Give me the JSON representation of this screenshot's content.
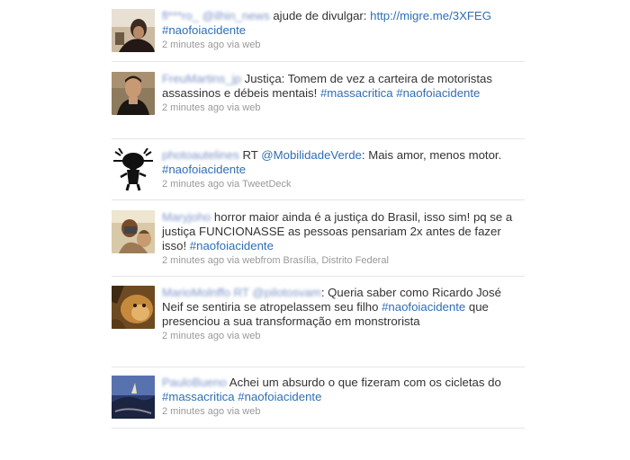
{
  "tweets": [
    {
      "user": "fl***ro_ @ilhin_news",
      "text_parts": [
        {
          "t": " ajude de divulgar: ",
          "k": "text"
        },
        {
          "t": "http://migre.me/3XFEG",
          "k": "link"
        },
        {
          "t": " ",
          "k": "text"
        },
        {
          "t": "#naofoiacidente",
          "k": "tag"
        }
      ],
      "time": "2 minutes ago",
      "via": "via",
      "source": "web",
      "location": ""
    },
    {
      "user": "FreuMartins_jp",
      "text_parts": [
        {
          "t": " Justiça: Tomem de vez a carteira de motoristas assassinos e débeis mentais! ",
          "k": "text"
        },
        {
          "t": "#massacritica",
          "k": "tag"
        },
        {
          "t": " ",
          "k": "text"
        },
        {
          "t": "#naofoiacidente",
          "k": "tag"
        }
      ],
      "time": "2 minutes ago",
      "via": "via",
      "source": "web",
      "location": ""
    },
    {
      "user": "photoautelines",
      "text_parts": [
        {
          "t": " RT ",
          "k": "text"
        },
        {
          "t": "@MobilidadeVerde",
          "k": "mention"
        },
        {
          "t": ": Mais amor, menos motor. ",
          "k": "text"
        },
        {
          "t": "#naofoiacidente",
          "k": "tag"
        }
      ],
      "time": "2 minutes ago",
      "via": "via",
      "source": "TweetDeck",
      "location": ""
    },
    {
      "user": "Maryjoho",
      "text_parts": [
        {
          "t": " horror maior ainda é a justiça do Brasil, isso sim! pq se a justiça FUNCIONASSE as pessoas pensariam 2x antes de fazer isso! ",
          "k": "text"
        },
        {
          "t": "#naofoiacidente",
          "k": "tag"
        }
      ],
      "time": "2 minutes ago",
      "via": "via",
      "source": "web",
      "location": "from Brasília, Distrito Federal"
    },
    {
      "user": "MarioMolnffo RT @pilotosvam",
      "text_parts": [
        {
          "t": ": Queria saber como Ricardo José Neif se sentiria se atropelassem seu filho ",
          "k": "text"
        },
        {
          "t": "#naofoiacidente",
          "k": "tag"
        },
        {
          "t": " que presenciou a sua transformação em monstrorista",
          "k": "text"
        }
      ],
      "time": "2 minutes ago",
      "via": "via",
      "source": "web",
      "location": ""
    },
    {
      "user": "PauloBueno",
      "text_parts": [
        {
          "t": " Achei um absurdo o que fizeram com os cicletas do ",
          "k": "text"
        },
        {
          "t": "#massacritica",
          "k": "tag"
        },
        {
          "t": " ",
          "k": "text"
        },
        {
          "t": "#naofoiacidente",
          "k": "tag"
        }
      ],
      "time": "2 minutes ago",
      "via": "via",
      "source": "web",
      "location": ""
    }
  ]
}
